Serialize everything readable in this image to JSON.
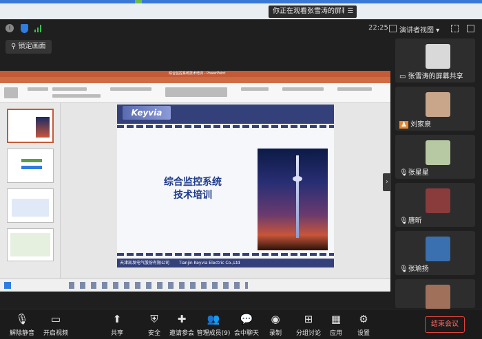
{
  "banner": {
    "viewing_text": "你正在观看张雪涛的屏幕",
    "menu_icon": "menu-icon"
  },
  "status": {
    "time": "22:25",
    "view_mode": "演讲者视图 ▾"
  },
  "lock_button": "锁定画面",
  "slide": {
    "logo": "Keyvia",
    "title_line1": "综合监控系统",
    "title_line2": "技术培训",
    "footer_cn": "天津凯发电气股份有限公司",
    "footer_en": "Tianjin Keyvia Electric Co.,Ltd"
  },
  "ppt_window_title": "综合监控系统技术培训 - PowerPoint",
  "participants": [
    {
      "name": "张雪涛的屏幕共享",
      "color": "#d9d9d9"
    },
    {
      "name": "刘家泉",
      "color": "#c9a58a"
    },
    {
      "name": "张星星",
      "color": "#b7c9a2"
    },
    {
      "name": "唐昕",
      "color": "#8a3b3b"
    },
    {
      "name": "张瑜扬",
      "color": "#3a6fb0"
    },
    {
      "name": "",
      "color": "#a0705a"
    }
  ],
  "toolbar": {
    "unmute": "解除静音",
    "video": "开启视频",
    "share": "共享",
    "security": "安全",
    "invite": "邀请参会",
    "members": "管理成员(9)",
    "chat": "会中聊天",
    "record": "录制",
    "breakout": "分组讨论",
    "apps": "应用",
    "settings": "设置",
    "end": "结束会议"
  }
}
